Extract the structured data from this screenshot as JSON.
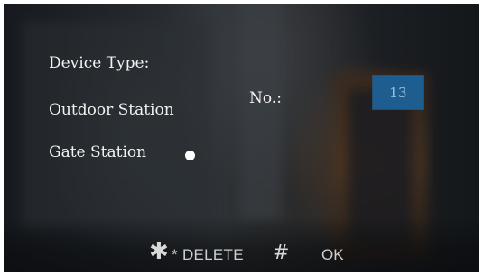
{
  "form": {
    "device_type_label": "Device Type:",
    "options": [
      {
        "label": "Outdoor Station",
        "selected": false
      },
      {
        "label": "Gate Station",
        "selected": true
      }
    ],
    "number_label": "No.:",
    "number_value": "13"
  },
  "footer": {
    "delete_key_icon": "asterisk-icon",
    "delete_key_glyph": "✱",
    "delete_label": "* DELETE",
    "ok_key_icon": "hash-icon",
    "ok_key_glyph": "#",
    "ok_label": "OK"
  },
  "colors": {
    "number_field_bg": "#1d5d8f",
    "text": "#f2f2f2",
    "selected_dot": "#ffffff"
  }
}
